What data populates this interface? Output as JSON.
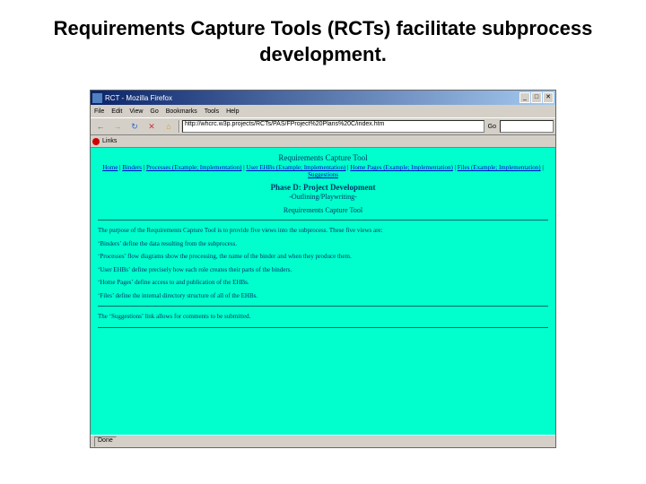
{
  "slide": {
    "title": "Requirements Capture Tools (RCTs) facilitate subprocess development."
  },
  "window": {
    "title": "RCT - Mozilla Firefox",
    "min": "_",
    "max": "□",
    "close": "✕"
  },
  "menu": {
    "file": "File",
    "edit": "Edit",
    "view": "View",
    "go": "Go",
    "bookmarks": "Bookmarks",
    "tools": "Tools",
    "help": "Help"
  },
  "toolbar": {
    "back": "←",
    "fwd": "→",
    "reload": "↻",
    "stop": "✕",
    "home": "⌂"
  },
  "address": {
    "label": "",
    "url": "http://whcrc.w3p.projects/RCTs/PAS/FProject%20Plans%20C/index.htm",
    "go": "Go",
    "search": ""
  },
  "links": {
    "label": "Links"
  },
  "doc": {
    "header": "Requirements Capture Tool",
    "nav_home": "Home",
    "nav_binders": "Binders",
    "nav_processes": "Processes (Example; Implementation)",
    "nav_ehbs": "User EHBs (Example; Implementation)",
    "nav_homepages": "Home Pages (Example; Implementation)",
    "nav_files": "Files (Example; Implementation)",
    "nav_suggestions": "Suggestions",
    "phase_title": "Phase D: Project Development",
    "phase_subtitle": "-Outlining/Playwriting-",
    "section_title": "Requirements Capture Tool",
    "intro": "The purpose of the Requirements Capture Tool is to provide five views into the subprocess. These five views are:",
    "binders_desc": "‘Binders’ define the data resulting from the subprocess.",
    "processes_desc": "‘Processes’ flow diagrams show the processing, the name of the binder and when they produce them.",
    "ehbs_desc": "‘User EHBs’ define precisely how each role creates their parts of the binders.",
    "homepages_desc": "‘Home Pages’ define access to and publication of the EHBs.",
    "files_desc": "‘Files’ define the internal directory structure of all of the EHBs.",
    "suggestions_desc": "The ‘Suggestions’ link allows for comments to be submitted."
  },
  "status": {
    "done": "Done"
  }
}
